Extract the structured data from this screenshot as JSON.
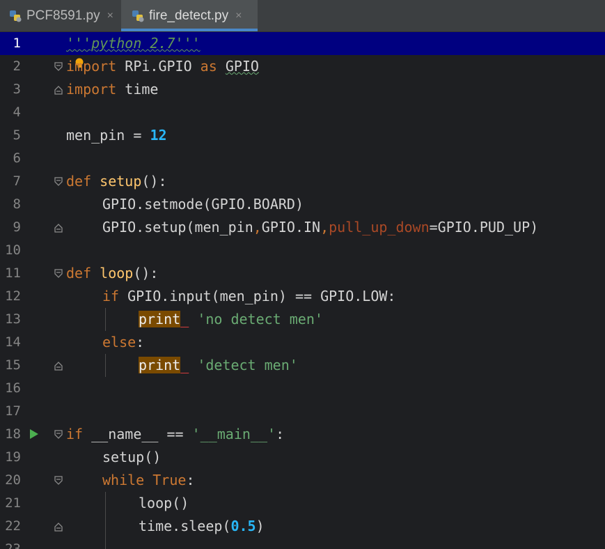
{
  "tabs": [
    {
      "label": "PCF8591.py",
      "close": "×",
      "active": false
    },
    {
      "label": "fire_detect.py",
      "close": "×",
      "active": true
    }
  ],
  "colors": {
    "background": "#1e1f22",
    "current_line": "#000080",
    "keyword": "#cc7832",
    "function": "#ffc66d",
    "number": "#29b6f6",
    "string": "#6aab73",
    "docstring": "#629755",
    "parameter": "#aa4926",
    "active_tab_underline": "#4a88c7"
  },
  "editor": {
    "current_line": 1,
    "line_numbers": [
      "1",
      "2",
      "3",
      "4",
      "5",
      "6",
      "7",
      "8",
      "9",
      "10",
      "11",
      "12",
      "13",
      "14",
      "15",
      "16",
      "17",
      "18",
      "19",
      "20",
      "21",
      "22",
      "23"
    ],
    "lines": {
      "l1": {
        "doc": "'''python 2.7'''"
      },
      "l2": {
        "kw1": "import",
        "mod": "RPi.GPIO",
        "kw2": "as",
        "alias": "GPIO"
      },
      "l3": {
        "kw1": "import",
        "mod": "time"
      },
      "l5": {
        "var": "men_pin",
        "op": "=",
        "num": "12"
      },
      "l7": {
        "kw": "def",
        "fn": "setup",
        "rest": "():"
      },
      "l8": {
        "code": "GPIO.setmode(GPIO.BOARD)"
      },
      "l9": {
        "a": "GPIO.setup(men_pin",
        "c1": ",",
        "b": "GPIO.IN",
        "c2": ",",
        "param": "pull_up_down",
        "d": "=GPIO.PUD_UP)"
      },
      "l11": {
        "kw": "def",
        "fn": "loop",
        "rest": "():"
      },
      "l12": {
        "kw": "if",
        "rest": "GPIO.input(men_pin) == GPIO.LOW:"
      },
      "l13": {
        "print": "print",
        "err": "_",
        "str": "'no detect men'"
      },
      "l14": {
        "kw": "else",
        "rest": ":"
      },
      "l15": {
        "print": "print",
        "err": "_",
        "str": "'detect men'"
      },
      "l18": {
        "kw": "if",
        "a": "__name__ ==",
        "str": "'__main__'",
        "rest": ":"
      },
      "l19": {
        "code": "setup()"
      },
      "l20": {
        "kw1": "while",
        "kw2": "True",
        "rest": ":"
      },
      "l21": {
        "code": "loop()"
      },
      "l22": {
        "a": "time.sleep(",
        "num": "0.5",
        "b": ")"
      }
    }
  }
}
